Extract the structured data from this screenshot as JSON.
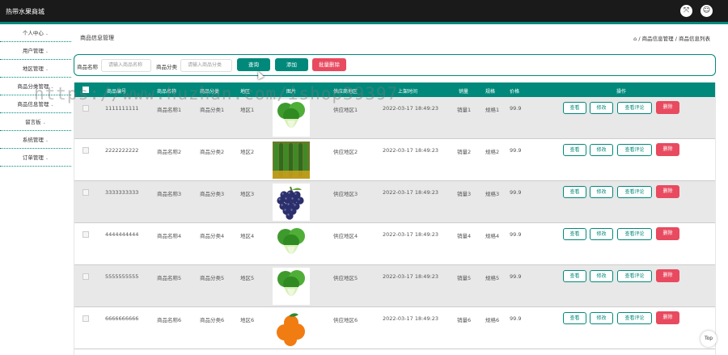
{
  "app": {
    "title": "热带水果商城"
  },
  "header": {
    "icons": [
      "fullscreen-icon",
      "user-icon"
    ]
  },
  "sidebar": {
    "items": [
      {
        "label": "个人中心"
      },
      {
        "label": "用户管理"
      },
      {
        "label": "地区管理"
      },
      {
        "label": "商品分类管理"
      },
      {
        "label": "商品信息管理"
      },
      {
        "label": "留言板"
      },
      {
        "label": "系统管理"
      },
      {
        "label": "订单管理"
      }
    ]
  },
  "page": {
    "title": "商品信息管理",
    "breadcrumb": [
      "⌂",
      "商品信息管理",
      "商品信息列表"
    ]
  },
  "search": {
    "name_label": "商品名称",
    "name_placeholder": "请输入商品名称",
    "cat_label": "商品分类",
    "cat_placeholder": "请输入商品分类",
    "query": "查询",
    "add": "添加",
    "batch_delete": "批量删除"
  },
  "table": {
    "headers": [
      "商品编号",
      "商品名称",
      "商品分类",
      "地区",
      "图片",
      "供应商地区",
      "上架时间",
      "销量",
      "规格",
      "价格",
      "操作"
    ],
    "actions": {
      "view": "查看",
      "edit": "修改",
      "comments": "查看评论",
      "delete": "删除"
    },
    "rows": [
      {
        "code": "1111111111",
        "name": "商品名称1",
        "category": "商品分类1",
        "region": "地区1",
        "image": "bok-choy",
        "supplier": "供应地区1",
        "time": "2022-03-17 18:49:23",
        "sales": "销量1",
        "spec": "规格1",
        "price": "99.9"
      },
      {
        "code": "2222222222",
        "name": "商品名称2",
        "category": "商品分类2",
        "region": "地区2",
        "image": "cucumbers",
        "supplier": "供应地区2",
        "time": "2022-03-17 18:49:23",
        "sales": "销量2",
        "spec": "规格2",
        "price": "99.9"
      },
      {
        "code": "3333333333",
        "name": "商品名称3",
        "category": "商品分类3",
        "region": "地区3",
        "image": "grapes",
        "supplier": "供应地区3",
        "time": "2022-03-17 18:49:23",
        "sales": "销量3",
        "spec": "规格3",
        "price": "99.9"
      },
      {
        "code": "4444444444",
        "name": "商品名称4",
        "category": "商品分类4",
        "region": "地区4",
        "image": "bok-choy",
        "supplier": "供应地区4",
        "time": "2022-03-17 18:49:23",
        "sales": "销量4",
        "spec": "规格4",
        "price": "99.9"
      },
      {
        "code": "5555555555",
        "name": "商品名称5",
        "category": "商品分类5",
        "region": "地区5",
        "image": "bok-choy",
        "supplier": "供应地区5",
        "time": "2022-03-17 18:49:23",
        "sales": "销量5",
        "spec": "规格5",
        "price": "99.9"
      },
      {
        "code": "6666666666",
        "name": "商品名称6",
        "category": "商品分类6",
        "region": "地区6",
        "image": "oranges",
        "supplier": "供应地区6",
        "time": "2022-03-17 18:49:23",
        "sales": "销量6",
        "spec": "规格6",
        "price": "99.9"
      }
    ]
  },
  "watermark": "https://www.huzhan.com/ishop39397",
  "back_to_top": "Top",
  "colors": {
    "accent": "#00897b",
    "danger": "#e84a5f",
    "topbar": "#1a1a1a"
  }
}
